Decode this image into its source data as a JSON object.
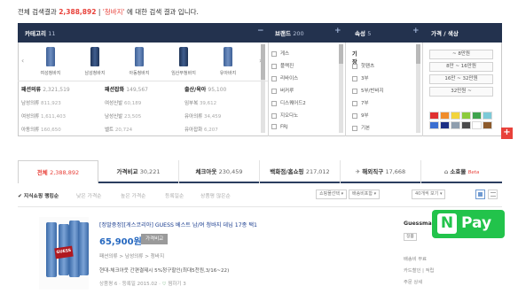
{
  "summary": {
    "prefix": "전체 검색결과",
    "count": "2,388,892",
    "keyword": "'청바지'",
    "suffix": "에 대한 검색 결과 입니다."
  },
  "filter_header": {
    "category": {
      "label": "카테고리",
      "count": "11"
    },
    "brand": {
      "label": "브랜드",
      "count": "200"
    },
    "attribute": {
      "label": "속성",
      "count": "5"
    },
    "price": {
      "label": "가격 / 색상"
    }
  },
  "category_thumbs": [
    "여성청바지",
    "남성청바지",
    "아동청바지",
    "임산부청바지",
    "유아바지"
  ],
  "category_columns": [
    {
      "title": "패션의류",
      "count": "2,321,519",
      "rows": [
        [
          "남성의류",
          "811,923"
        ],
        [
          "여성의류",
          "1,611,403"
        ],
        [
          "아동의류",
          "160,650"
        ]
      ]
    },
    {
      "title": "패션잡화",
      "count": "149,567",
      "rows": [
        [
          "여성신발",
          "60,189"
        ],
        [
          "남성신발",
          "23,505"
        ],
        [
          "벨트",
          "20,724"
        ]
      ]
    },
    {
      "title": "출산/육아",
      "count": "95,100",
      "rows": [
        [
          "임부복",
          "39,612"
        ],
        [
          "유아의류",
          "34,459"
        ],
        [
          "유아잡화",
          "6,207"
        ]
      ]
    }
  ],
  "brands": [
    "게스",
    "플랙진",
    "리바이스",
    "버커루",
    "디스퀘어드2",
    "지오다노",
    "FRJ"
  ],
  "attribute": {
    "group": "기장",
    "items": [
      "핫팬츠",
      "3부",
      "5부/반바지",
      "7부",
      "9부",
      "기본"
    ]
  },
  "price_ranges": [
    "~ 8만원",
    "8만 ~ 16만원",
    "16만 ~ 32만원",
    "32만원 ~"
  ],
  "colors": [
    "#e03131",
    "#f08c2a",
    "#f2d43c",
    "#8ccb3c",
    "#3fa34d",
    "#7ccad8",
    "#3b6fd1",
    "#1c2f84",
    "#8e9dad",
    "#4a4a4a",
    "#ffffff",
    "#8c5a2b"
  ],
  "tabs": [
    {
      "label": "전체",
      "count": "2,388,892"
    },
    {
      "label": "가격비교",
      "count": "30,221"
    },
    {
      "label": "체크아웃",
      "count": "230,459"
    },
    {
      "label": "백화점/홈쇼핑",
      "count": "217,012"
    },
    {
      "label": "해외직구",
      "count": "17,668"
    },
    {
      "label": "소호몰",
      "count": "",
      "beta": "Beta"
    }
  ],
  "sort": {
    "options": [
      "✔ 지식쇼핑 랭킹순",
      "낮은 가격순",
      "높은 가격순",
      "등록일순",
      "상품평 많은순"
    ],
    "seller_select": "쇼핑몰선택 ▾",
    "period_select": "배송비포함 ▾",
    "per_page_select": "40개씩 보기 ▾"
  },
  "product": {
    "title": "[정말중정][게스코리아] GUESS 베스트 남/여 청바지 데님 17종 택1",
    "price": "65,900원",
    "compare_label": "가격비교",
    "category_trail": "패션의류 > 남성의류 > 청바지",
    "ship_note": "현대-체크아웃 간편결제시 5%청구할인(최대5천원,3/16~22)",
    "reviews": "상품평 6",
    "date": "등록일 2015.02",
    "zzim": "찜하기 3",
    "logo_text": "GUESS"
  },
  "seller": {
    "name": "Guessmall",
    "badge": "정품",
    "info": [
      "배송비 무료",
      "카드할인 | 적립",
      "주문 상세"
    ]
  },
  "npay": {
    "n": "N",
    "label": "Pay"
  }
}
